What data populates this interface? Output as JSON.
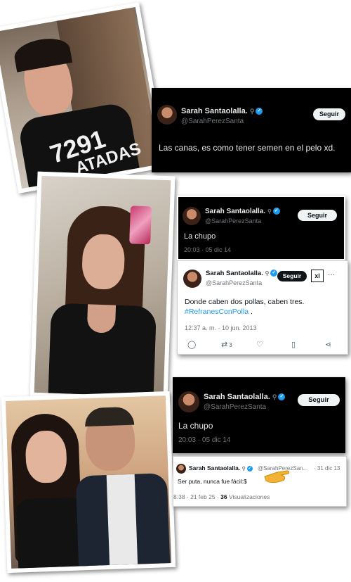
{
  "tweet1": {
    "name": "Sarah Santaolalla.",
    "handle": "@SarahPerezSanta",
    "follow": "Seguir",
    "text": "Las canas, es como tener semen en el pelo xd."
  },
  "tweet2": {
    "name": "Sarah Santaolalla.",
    "handle": "@SarahPerezSanta",
    "follow": "Seguir",
    "text": "La chupo",
    "time": "20:03 · 05 dic 14"
  },
  "tweet3": {
    "name": "Sarah Santaolalla.",
    "handle": "@SarahPerezSanta",
    "follow": "Seguir",
    "text_line1": "Donde caben dos pollas, caben tres.",
    "hashtag": "#RefranesConPolla",
    "hashtag_suffix": " .",
    "time": "12:37 a. m. · 10 jun. 2013",
    "retweets": "3",
    "xl_badge": "xl",
    "more": "···"
  },
  "tweet4": {
    "name": "Sarah Santaolalla.",
    "handle": "@SarahPerezSanta",
    "follow": "Seguir",
    "text": "La chupo",
    "time": "20:03 · 05 dic 14"
  },
  "tweet5": {
    "name": "Sarah Santaolalla.",
    "handle": "@SarahPerezSan...",
    "date": "· 31 dic 13",
    "text": "Ser puta, nunca fue fácil:$",
    "footer_time": "8:38 · 21 feb 25 · ",
    "views_count": "36",
    "views_label": " Visualizaciones"
  },
  "photo1": {
    "shirt_text_line1": "7291",
    "shirt_text_line2": "ATADAS"
  },
  "icons": {
    "reply": "reply-icon",
    "retweet": "retweet-icon",
    "like": "heart-icon",
    "bookmark": "bookmark-icon",
    "share": "share-icon",
    "location": "pin-icon",
    "verified": "verified-icon",
    "pointing_hand": "pointing-hand-icon"
  },
  "colors": {
    "twitter_blue": "#1d9bf0",
    "dark_bg": "#000000",
    "gray": "#71767b"
  }
}
